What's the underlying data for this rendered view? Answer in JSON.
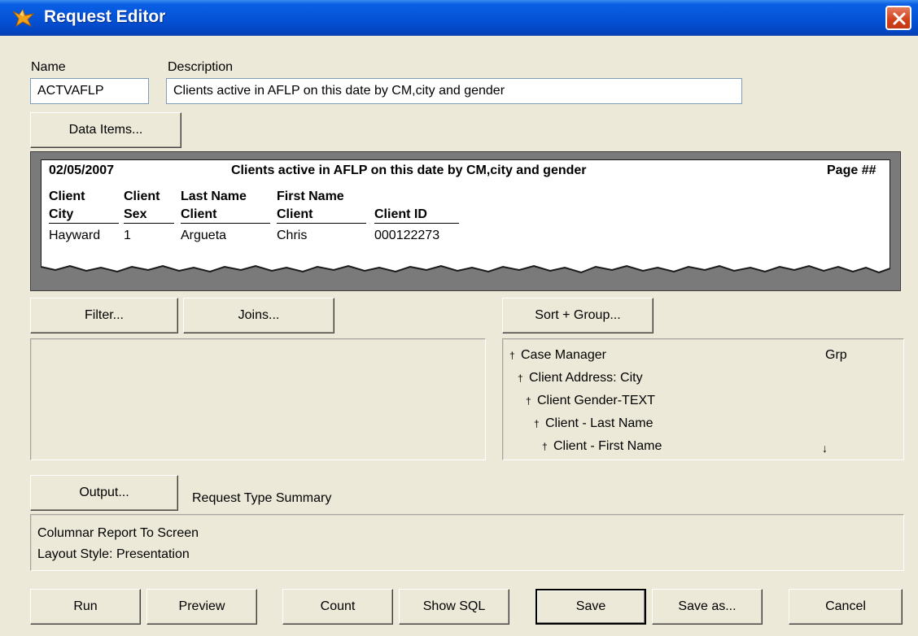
{
  "window": {
    "title": "Request Editor"
  },
  "name_field": {
    "label": "Name",
    "value": "ACTVAFLP"
  },
  "description_field": {
    "label": "Description",
    "value": "Clients active in AFLP on this date by CM,city and gender"
  },
  "data_items_button": {
    "label": "Data Items..."
  },
  "report_preview": {
    "date": "02/05/2007",
    "title": "Clients active in AFLP on this date by CM,city and gender",
    "page": "Page ##",
    "headers": [
      {
        "line1": "Client",
        "line2": "City"
      },
      {
        "line1": "Client",
        "line2": "Sex"
      },
      {
        "line1": "Last Name",
        "line2": "Client"
      },
      {
        "line1": "First Name",
        "line2": "Client"
      },
      {
        "line1": "",
        "line2": "Client ID"
      }
    ],
    "rows": [
      [
        "Hayward",
        "1",
        "Argueta",
        "Chris",
        "000122273"
      ]
    ]
  },
  "buttons": {
    "filter": "Filter...",
    "joins": "Joins...",
    "sort_group": "Sort + Group...",
    "output": "Output...",
    "run": "Run",
    "preview": "Preview",
    "count": "Count",
    "show_sql": "Show SQL",
    "save": "Save",
    "save_as": "Save as...",
    "cancel": "Cancel"
  },
  "sort_group": {
    "grp_label": "Grp",
    "items": [
      {
        "label": "Case Manager",
        "icon": "sort-ascending-icon"
      },
      {
        "label": "Client Address: City",
        "icon": "sort-ascending-icon"
      },
      {
        "label": "Client Gender-TEXT",
        "icon": "sort-ascending-icon"
      },
      {
        "label": "Client - Last Name",
        "icon": "sort-ascending-icon"
      },
      {
        "label": "Client - First Name",
        "icon": "sort-ascending-icon"
      }
    ],
    "group_marker": "↓"
  },
  "request_type": {
    "label": "Request Type Summary",
    "lines": [
      "Columnar Report To Screen",
      "Layout Style: Presentation"
    ]
  },
  "colors": {
    "title_bar": "#0452d6",
    "window_bg": "#ece9d8",
    "close_button": "#d2401c"
  }
}
